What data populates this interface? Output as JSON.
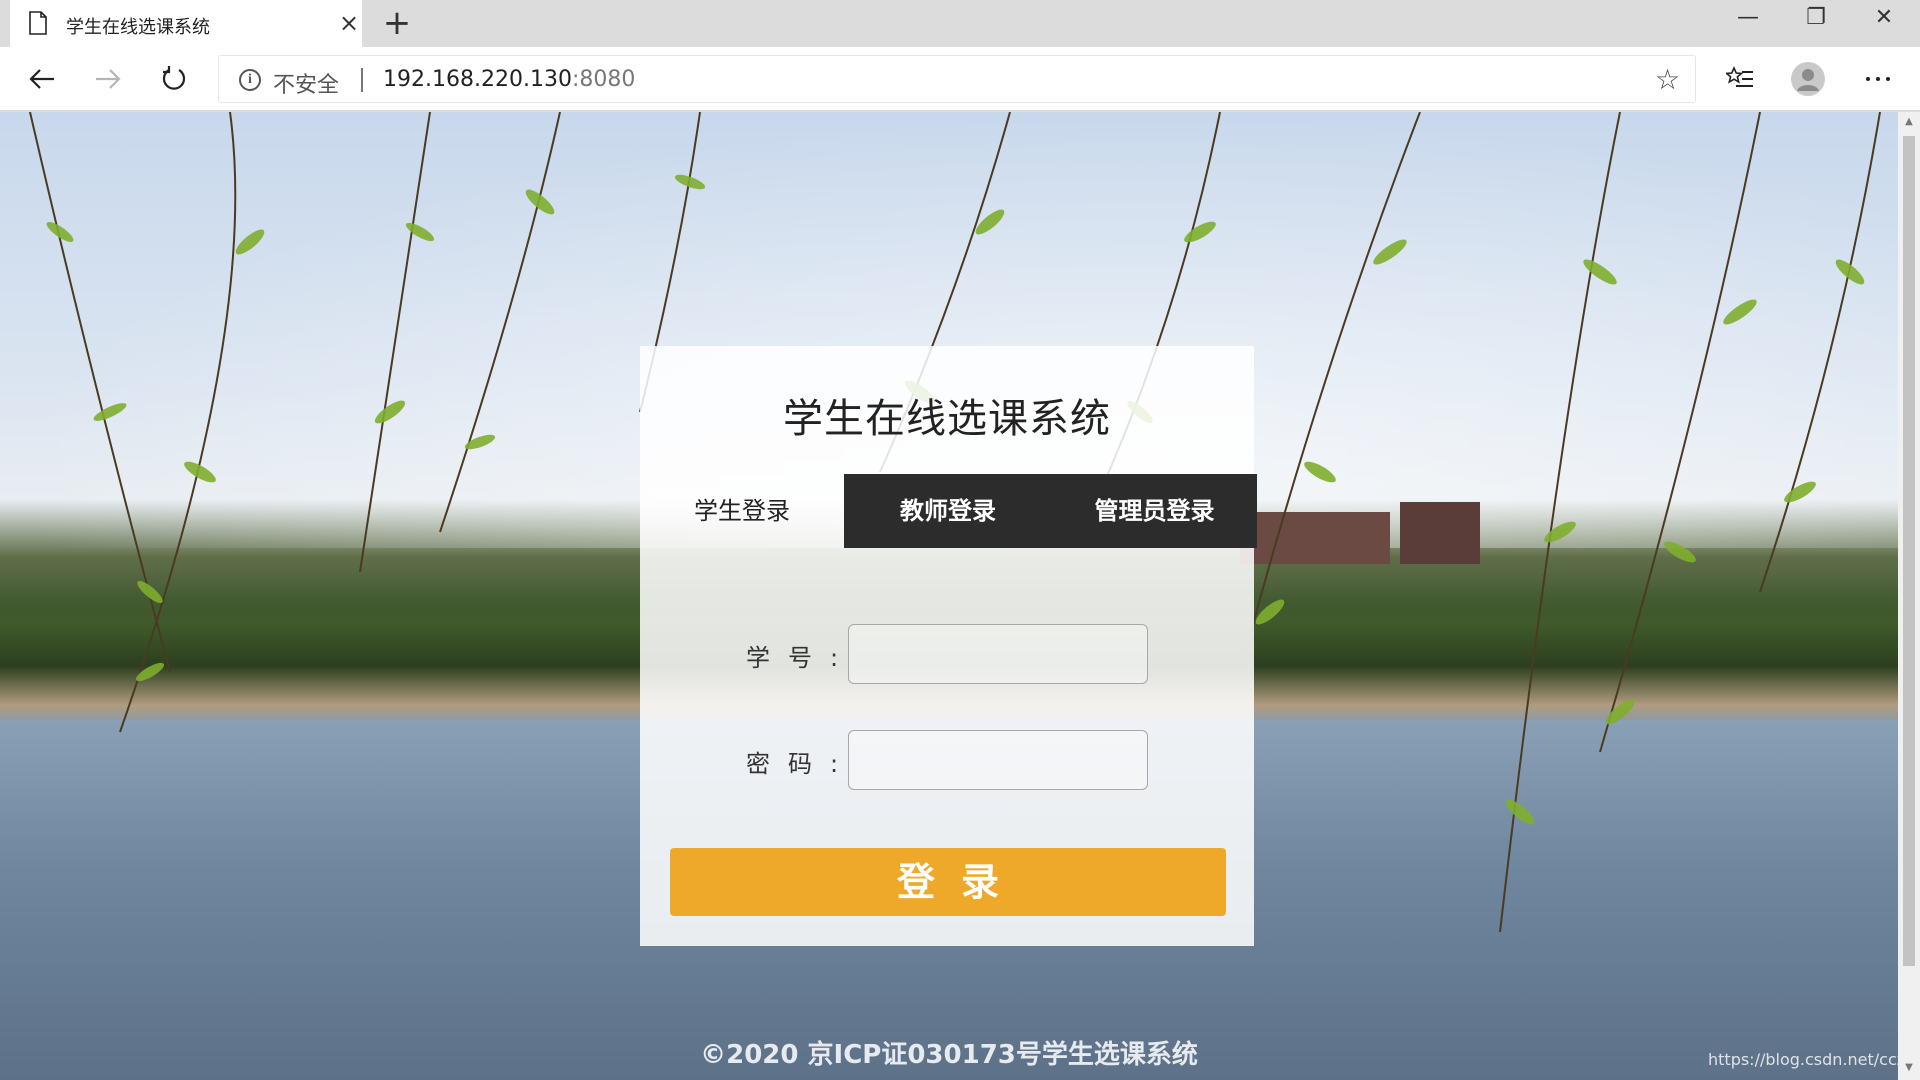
{
  "browser": {
    "tab_title": "学生在线选课系统",
    "tab_close": "×",
    "new_tab": "+",
    "window": {
      "minimize": "—",
      "restore": "❐",
      "close": "✕"
    },
    "address": {
      "security_label": "不安全",
      "host": "192.168.220.130",
      "port": ":8080"
    },
    "icons": {
      "back": "back-arrow-icon",
      "forward": "forward-arrow-icon",
      "refresh": "refresh-icon",
      "info": "info-icon",
      "favorite": "star-icon",
      "favorites_list": "favorites-list-icon",
      "profile": "profile-avatar-icon",
      "menu": "more-menu-icon"
    }
  },
  "login": {
    "title": "学生在线选课系统",
    "tabs": [
      {
        "label": "学生登录",
        "active": true
      },
      {
        "label": "教师登录",
        "active": false
      },
      {
        "label": "管理员登录",
        "active": false
      }
    ],
    "fields": [
      {
        "label": "学号:",
        "value": "",
        "placeholder": ""
      },
      {
        "label": "密码:",
        "value": "",
        "placeholder": ""
      }
    ],
    "submit_label": "登录"
  },
  "footer": {
    "copyright": "©2020  京ICP证030173号学生选课系统"
  },
  "watermark": "https://blog.csdn.net/cczxc",
  "colors": {
    "accent": "#eea92b",
    "tab_dark": "#2c2c2c"
  }
}
